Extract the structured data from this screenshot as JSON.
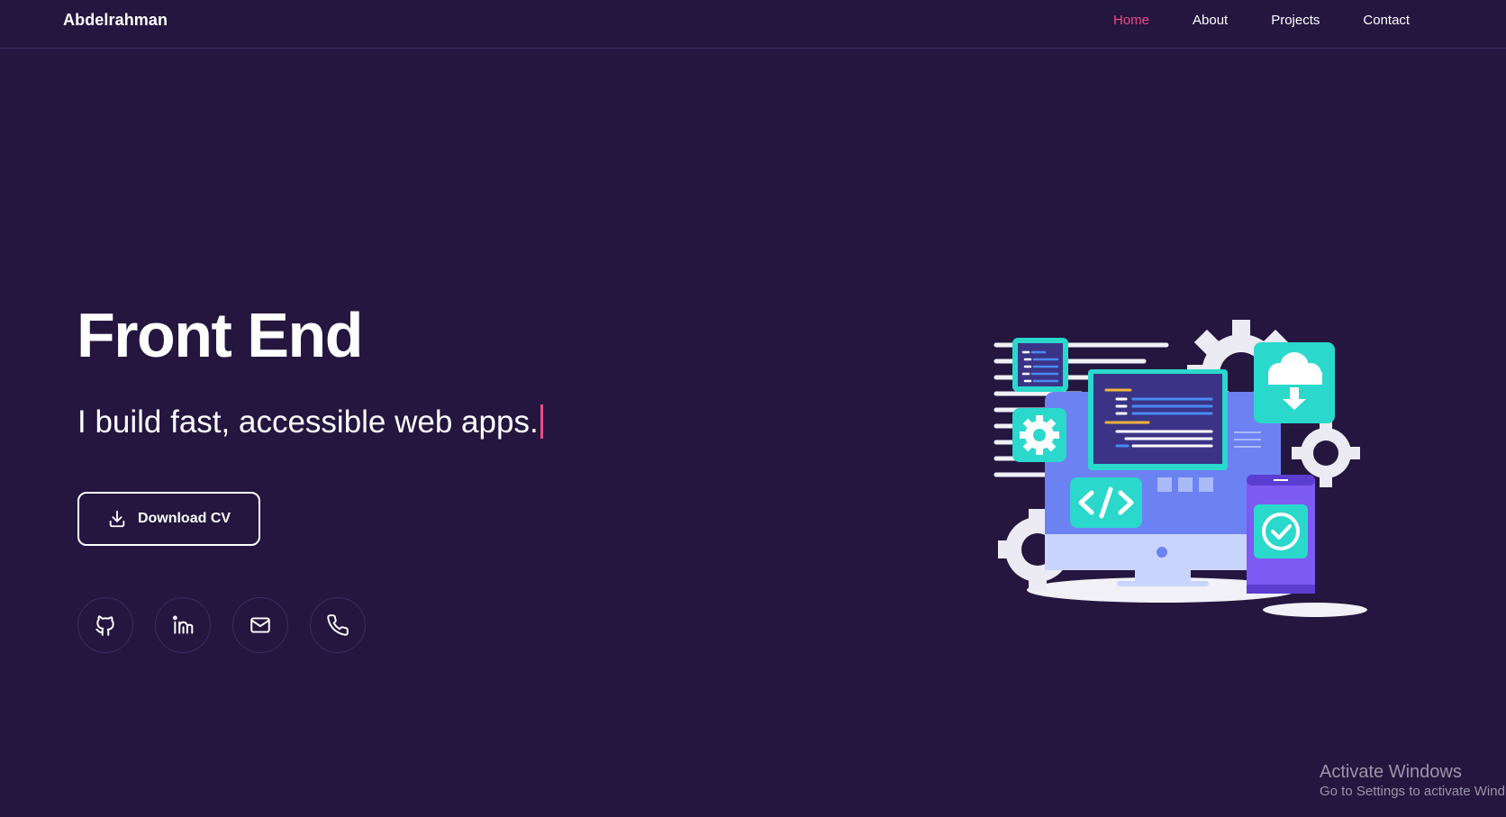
{
  "brand": "Abdelrahman",
  "nav": {
    "items": [
      {
        "label": "Home",
        "active": true
      },
      {
        "label": "About",
        "active": false
      },
      {
        "label": "Projects",
        "active": false
      },
      {
        "label": "Contact",
        "active": false
      }
    ]
  },
  "hero": {
    "title": "Front End",
    "subtitle": "I build fast, accessible web apps.",
    "download_label": "Download CV"
  },
  "socials": [
    "github-icon",
    "linkedin-icon",
    "mail-icon",
    "phone-icon"
  ],
  "colors": {
    "background": "#24163f",
    "accent": "#ec4a88",
    "teal": "#2ad8cc",
    "periwinkle": "#6c82f2"
  },
  "watermark": {
    "title": "Activate Windows",
    "subtitle": "Go to Settings to activate Wind"
  }
}
